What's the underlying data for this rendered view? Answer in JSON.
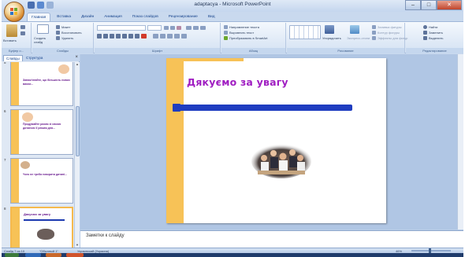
{
  "window": {
    "title": "adaptacya - Microsoft PowerPoint",
    "minimize": "–",
    "maximize": "□",
    "close": "✕"
  },
  "ribbon": {
    "tabs": [
      "Главная",
      "Вставка",
      "Дизайн",
      "Анимация",
      "Показ слайдов",
      "Рецензирование",
      "Вид"
    ],
    "clipboard": {
      "paste": "Вставить",
      "cut": "Вырезать",
      "copy": "Копировать",
      "label": "Буфер о..."
    },
    "slides": {
      "new_slide": "Создать слайд",
      "layout": "Макет",
      "reset": "Восстановить",
      "delete": "Удалить",
      "label": "Слайды"
    },
    "font": {
      "label": "Шрифт"
    },
    "paragraph": {
      "text_direction": "Направление текста",
      "align_text": "Выровнять текст",
      "convert": "Преобразовать в SmartArt",
      "label": "Абзац"
    },
    "drawing": {
      "arrange": "Упорядочить",
      "quick_styles": "Экспресс-стили",
      "shape_fill": "Заливка фигуры",
      "shape_outline": "Контур фигуры",
      "shape_effects": "Эффекты для фигур",
      "label": "Рисование"
    },
    "editing": {
      "find": "Найти",
      "replace": "Заменить",
      "select": "Выделить",
      "label": "Редактирование"
    }
  },
  "slides_pane": {
    "tabs": [
      "Слайды",
      "Структура"
    ],
    "close": "×",
    "thumbnails": [
      {
        "number": "5",
        "text": "Запам'ятайте, що більшість нових вимог..."
      },
      {
        "number": "6",
        "text": "Продумайте разом зі своєю дитиною її режим дня..."
      },
      {
        "number": "7",
        "text": "Чого не треба говорити дитині..."
      },
      {
        "number": "8",
        "text": "Дякуємо за увагу"
      }
    ]
  },
  "slide": {
    "title": "Дякуємо за увагу"
  },
  "notes": {
    "placeholder": "Заметки к слайду"
  },
  "status": {
    "slide_info": "Слайд 7 из 10",
    "theme": "\"Обычный 1\"",
    "language": "Украинский (Украина)",
    "zoom": "46%",
    "zoom_fraction": 0.46
  },
  "colors": {
    "accent_orange": "#f7c257",
    "title_purple": "#a01ec2",
    "line_blue": "#1f3dc0",
    "ribbon_blue": "#c9d9ee"
  }
}
